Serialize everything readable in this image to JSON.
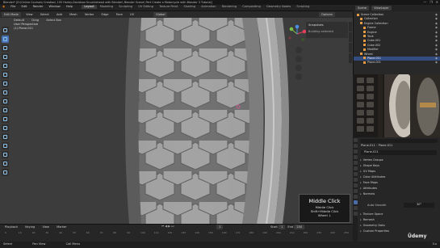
{
  "window": {
    "title": "Blender* [D:\\Online Courses\\ Creation\\ 105 Harley-Davidson Knucklehead with Blender\\ Blender Scene\\ Part Create a Motorcycle with Blender 3 Tutorial]",
    "controls": [
      "—",
      "❐",
      "✕"
    ]
  },
  "menu": {
    "items": [
      "File",
      "Edit",
      "Render",
      "Window",
      "Help"
    ],
    "workspaces": [
      "Layout",
      "Modeling",
      "Sculpting",
      "UV Editing",
      "Texture Paint",
      "Shading",
      "Animation",
      "Rendering",
      "Compositing",
      "Geometry Nodes",
      "Scripting"
    ],
    "active_workspace": "Layout",
    "scene": "Scene",
    "view_layer": "ViewLayer"
  },
  "viewport_header": {
    "mode": "Edit Mode",
    "view": "View",
    "select": "Select",
    "add": "Add",
    "mesh": "Mesh",
    "vertex": "Vertex",
    "edge": "Edge",
    "face": "Face",
    "uv": "UV",
    "orientation": "Global",
    "pivot": "Default",
    "drag": "Drag",
    "select_box": "Select Box",
    "options": "Options"
  },
  "viewport_info": {
    "line1": "User Perspective",
    "line2": "(1) Plane.011"
  },
  "n_panel": {
    "title": "Snapshots",
    "content": "Building selected"
  },
  "key_overlay": {
    "title": "Middle Click",
    "line1": "Middle Click",
    "line2": "Shift+Middle Click",
    "line3": "Wheel ↓"
  },
  "timeline": {
    "items": [
      "Playback",
      "Keying",
      "View",
      "Marker"
    ],
    "ticks": [
      "0",
      "10",
      "20",
      "30",
      "40",
      "50",
      "60",
      "70",
      "80",
      "90",
      "100",
      "110",
      "120",
      "130",
      "140",
      "150",
      "160",
      "170",
      "180",
      "190",
      "200",
      "210",
      "220",
      "230",
      "240",
      "250"
    ],
    "current_frame": "1",
    "start_label": "Start",
    "start": "1",
    "end_label": "End",
    "end": "250"
  },
  "statusbar": {
    "left": "Select",
    "mid": "Pan View",
    "right": "Call Menu",
    "version": "3.x"
  },
  "outliner": {
    "rows": [
      {
        "label": "Scene Collection",
        "selected": false
      },
      {
        "label": "Collection",
        "selected": false
      },
      {
        "label": "Engine Collection",
        "selected": false
      },
      {
        "label": "Frame",
        "selected": false
      },
      {
        "label": "Engine",
        "selected": false
      },
      {
        "label": "Tank",
        "selected": false
      },
      {
        "label": "Cube.001",
        "selected": false
      },
      {
        "label": "Cube.002",
        "selected": false
      },
      {
        "label": "Modifier",
        "selected": false
      },
      {
        "label": "Wheel",
        "selected": false
      },
      {
        "label": "Plane.011",
        "selected": true
      },
      {
        "label": "Plane.001",
        "selected": false
      }
    ]
  },
  "properties": {
    "object_name": "Plane.011",
    "data_name": "Plane.011",
    "mesh_name": "Plane.011",
    "sections": [
      "Vertex Groups",
      "Shape Keys",
      "UV Maps",
      "Color Attributes",
      "Face Maps",
      "Attributes",
      "Normals",
      "Texture Space",
      "Remesh",
      "Geometry Data",
      "Custom Properties"
    ],
    "auto_smooth_label": "Auto Smooth",
    "auto_smooth_value": "30°"
  },
  "watermark": "Ûdemy",
  "colors": {
    "accent": "#4772b3",
    "selection": "#334d80",
    "viewport_bg": "#3d3d3d",
    "tire": "#8f8f8f"
  }
}
